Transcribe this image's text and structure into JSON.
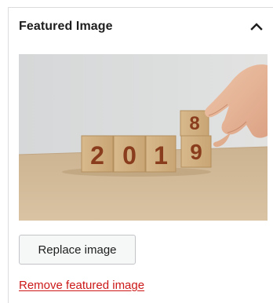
{
  "panel": {
    "title": "Featured Image",
    "toggle_icon": "chevron-up-icon"
  },
  "featured_image": {
    "blocks_bottom_row": [
      "2",
      "0",
      "1",
      "9"
    ],
    "block_top": "8"
  },
  "actions": {
    "replace_label": "Replace image",
    "remove_label": "Remove featured image"
  },
  "colors": {
    "link_danger": "#cc1818",
    "button_bg": "#f6f7f7",
    "digit_color": "#8a3d1c"
  }
}
